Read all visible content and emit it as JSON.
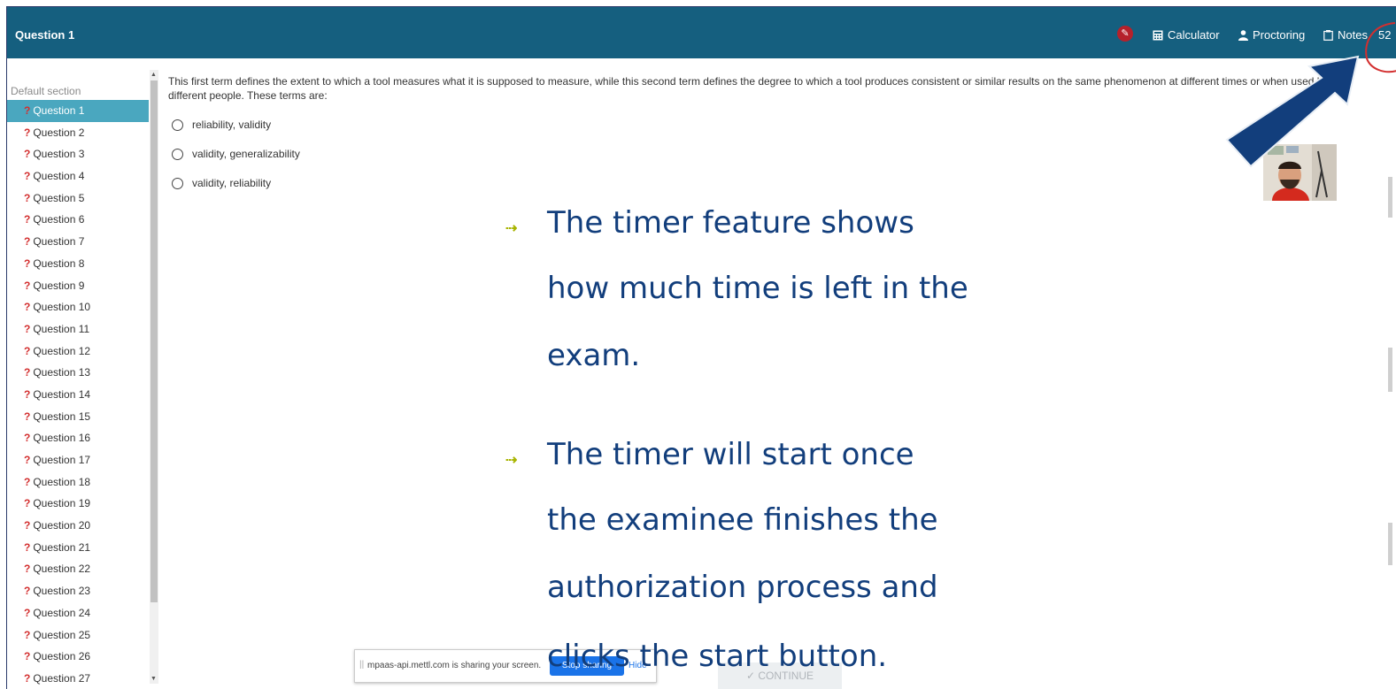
{
  "header": {
    "question_title": "Question 1",
    "calculator_label": "Calculator",
    "proctoring_label": "Proctoring",
    "notes_label": "Notes",
    "timer_partial": "52"
  },
  "sidebar": {
    "section_title": "Default section",
    "questions": [
      "Question 1",
      "Question 2",
      "Question 3",
      "Question 4",
      "Question 5",
      "Question 6",
      "Question 7",
      "Question 8",
      "Question 9",
      "Question 10",
      "Question 11",
      "Question 12",
      "Question 13",
      "Question 14",
      "Question 15",
      "Question 16",
      "Question 17",
      "Question 18",
      "Question 19",
      "Question 20",
      "Question 21",
      "Question 22",
      "Question 23",
      "Question 24",
      "Question 25",
      "Question 26",
      "Question 27"
    ],
    "active_index": 0,
    "unanswered_marker": "?"
  },
  "question": {
    "text": "This first term defines the extent to which a tool measures what it is supposed to measure, while this second term defines the degree to which a tool produces consistent or similar results on the same phenomenon at different times or when used by different people. These terms are:",
    "options": [
      "reliability, validity",
      "validity, generalizability",
      "validity, reliability"
    ]
  },
  "overlay": {
    "lines": [
      "The timer feature shows",
      "how much time is left in the",
      "exam.",
      "The timer will start once",
      "the examinee finishes the",
      "authorization process and",
      "clicks the start button."
    ]
  },
  "share_bar": {
    "message": "mpaas-api.mettl.com is sharing your screen.",
    "stop_label": "Stop sharing",
    "hide_label": "Hide"
  },
  "continue_label": "CONTINUE",
  "colors": {
    "header_bg": "#155f7f",
    "active_question_bg": "#4aa7bf",
    "overlay_text": "#123e7c",
    "arrow": "#123e7c",
    "highlight_circle": "#d32f2f"
  },
  "icons": {
    "header": [
      "no-edit-icon",
      "calculator-icon",
      "person-icon",
      "notes-icon"
    ],
    "overlay": [
      "pointer-arrow-icon",
      "bullet-arrow-icon"
    ]
  }
}
